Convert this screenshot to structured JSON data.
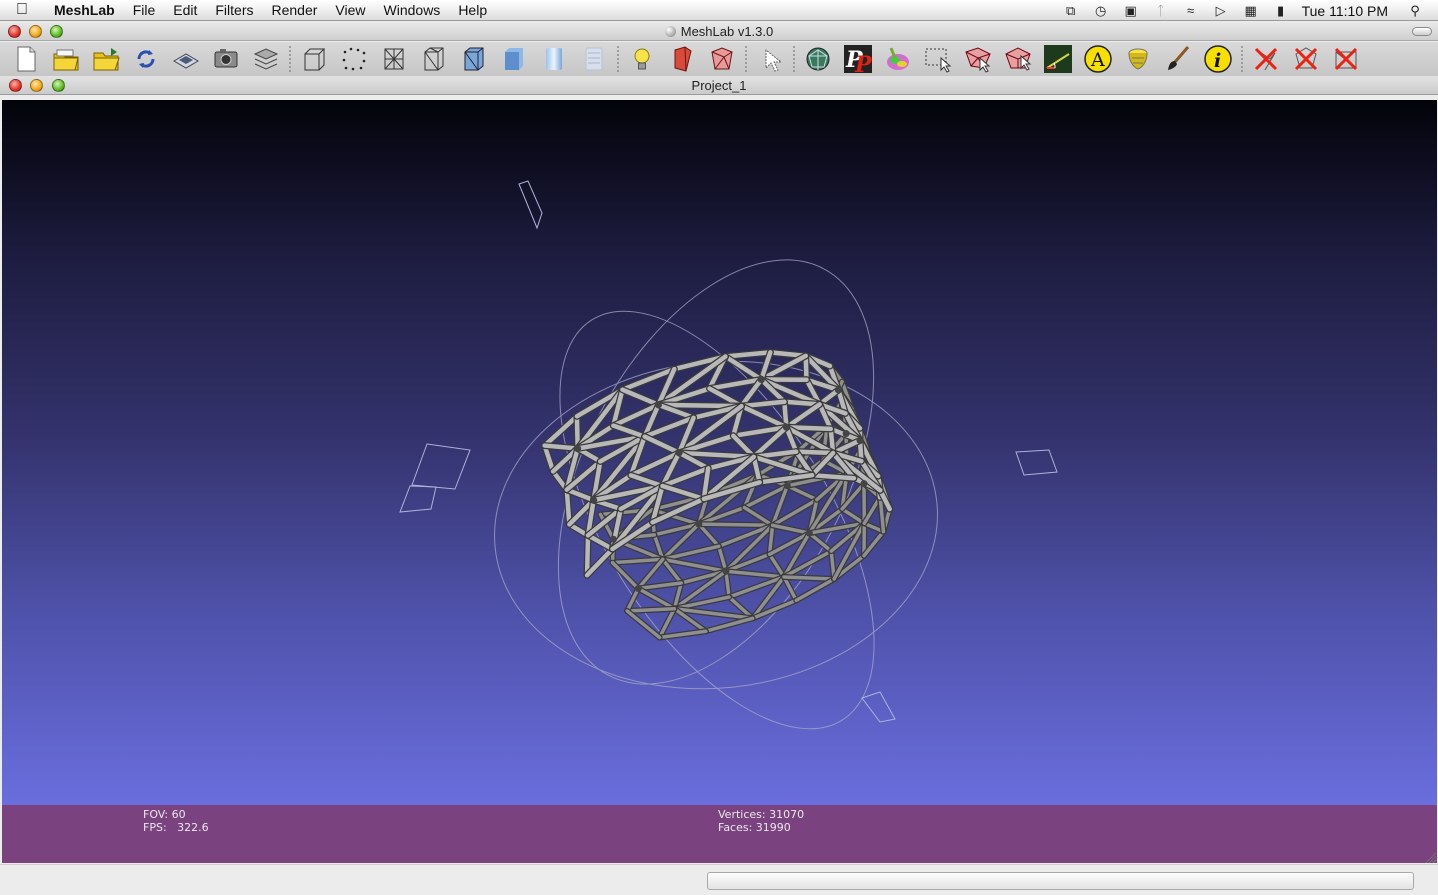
{
  "menubar": {
    "app_name": "MeshLab",
    "items": [
      "File",
      "Edit",
      "Filters",
      "Render",
      "View",
      "Windows",
      "Help"
    ],
    "clock": "Tue 11:10 PM"
  },
  "window": {
    "title": "MeshLab v1.3.0"
  },
  "toolbar": {
    "groups": [
      [
        "new-document",
        "open-mesh",
        "open-project",
        "reload",
        "save",
        "snapshot",
        "layers"
      ],
      [
        "bounding-box",
        "points",
        "wireframe",
        "hidden-lines",
        "flat-lines",
        "flat",
        "smooth",
        "texture"
      ],
      [
        "light",
        "backface",
        "double-side"
      ],
      [
        "select-vertices"
      ],
      [
        "mesh-info",
        "pickpoints",
        "paint-color",
        "select-faces-rect",
        "select-connected",
        "move-selection",
        "measure-tool",
        "align-a",
        "quality-mapper",
        "paintbrush",
        "info"
      ],
      [
        "delete-selected-faces",
        "delete-selected-vertices",
        "delete-selected-all"
      ]
    ]
  },
  "document": {
    "title": "Project_1"
  },
  "viewport_info": {
    "fov": "FOV: 60",
    "fps": "FPS:   322.6",
    "vertices": "Vertices: 31070",
    "faces": "Faces: 31990"
  },
  "colors": {
    "viewport_top": "#03030a",
    "viewport_bottom": "#6a6ede",
    "infobar": "#7a4380",
    "mesh": "#b8b8b8"
  }
}
